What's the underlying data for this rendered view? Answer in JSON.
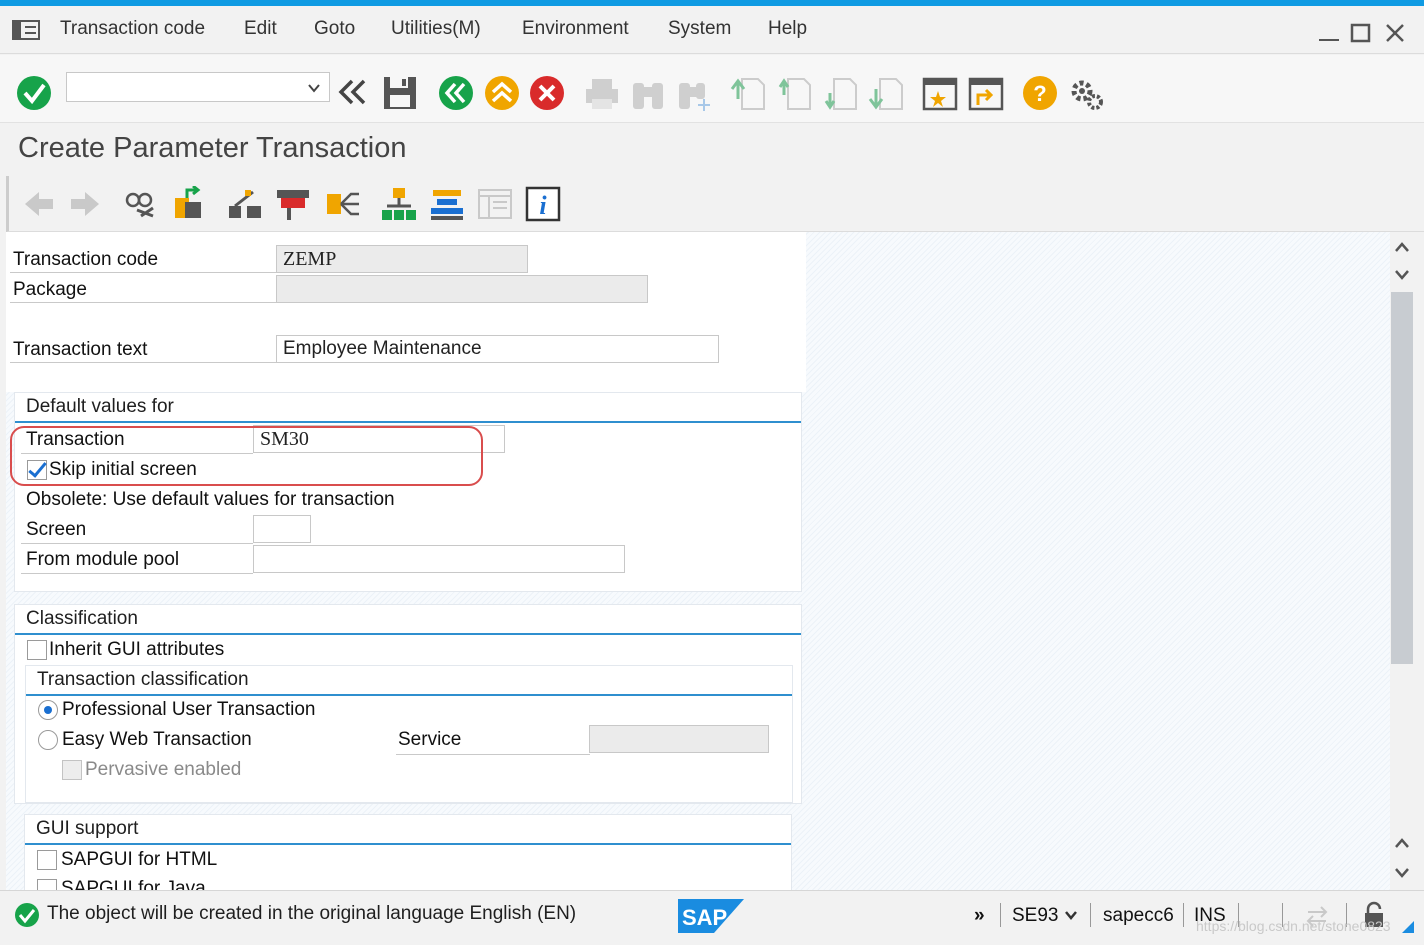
{
  "menubar": {
    "items": [
      "Transaction code",
      "Edit",
      "Goto",
      "Utilities(M)",
      "Environment",
      "System",
      "Help"
    ]
  },
  "toolbar": {
    "command_field_value": "",
    "icons": [
      "enter-icon",
      "back-double-arrow-icon",
      "save-icon",
      "back-icon",
      "exit-icon",
      "cancel-icon",
      "print-icon",
      "find-icon",
      "find-next-icon",
      "first-page-icon",
      "previous-page-icon",
      "next-page-icon",
      "last-page-icon",
      "create-session-icon",
      "generate-shortcut-icon",
      "help-icon",
      "customize-layout-icon"
    ]
  },
  "title": "Create Parameter Transaction",
  "form": {
    "transaction_code_label": "Transaction code",
    "transaction_code_value": "ZEMP",
    "package_label": "Package",
    "package_value": "",
    "transaction_text_label": "Transaction text",
    "transaction_text_value": "Employee Maintenance"
  },
  "defaults_group": {
    "header": "Default values for",
    "transaction_label": "Transaction",
    "transaction_value": "SM30",
    "skip_initial_label": "Skip initial screen",
    "skip_initial_checked": true,
    "obsolete_text": "Obsolete: Use default values for transaction",
    "screen_label": "Screen",
    "screen_value": "",
    "module_pool_label": "From module pool",
    "module_pool_value": ""
  },
  "classification": {
    "header": "Classification",
    "inherit_label": "Inherit GUI attributes",
    "trans_class_header": "Transaction classification",
    "professional_label": "Professional User Transaction",
    "easy_web_label": "Easy Web Transaction",
    "service_label": "Service",
    "service_value": "",
    "pervasive_label": "Pervasive enabled"
  },
  "gui_support": {
    "header": "GUI support",
    "html_label": "SAPGUI for HTML",
    "java_label": "SAPGUI for Java"
  },
  "status": {
    "message": "The object will be created in the original language English (EN)",
    "transaction": "SE93",
    "system": "sapecc6",
    "mode": "INS",
    "logo": "SAP",
    "watermark": "https://blog.csdn.net/stone0823"
  },
  "colors": {
    "accent": "#109be3",
    "green": "#17a34a",
    "yellow": "#f0a500",
    "red": "#d92b2b",
    "highlight": "#d94d4d"
  }
}
